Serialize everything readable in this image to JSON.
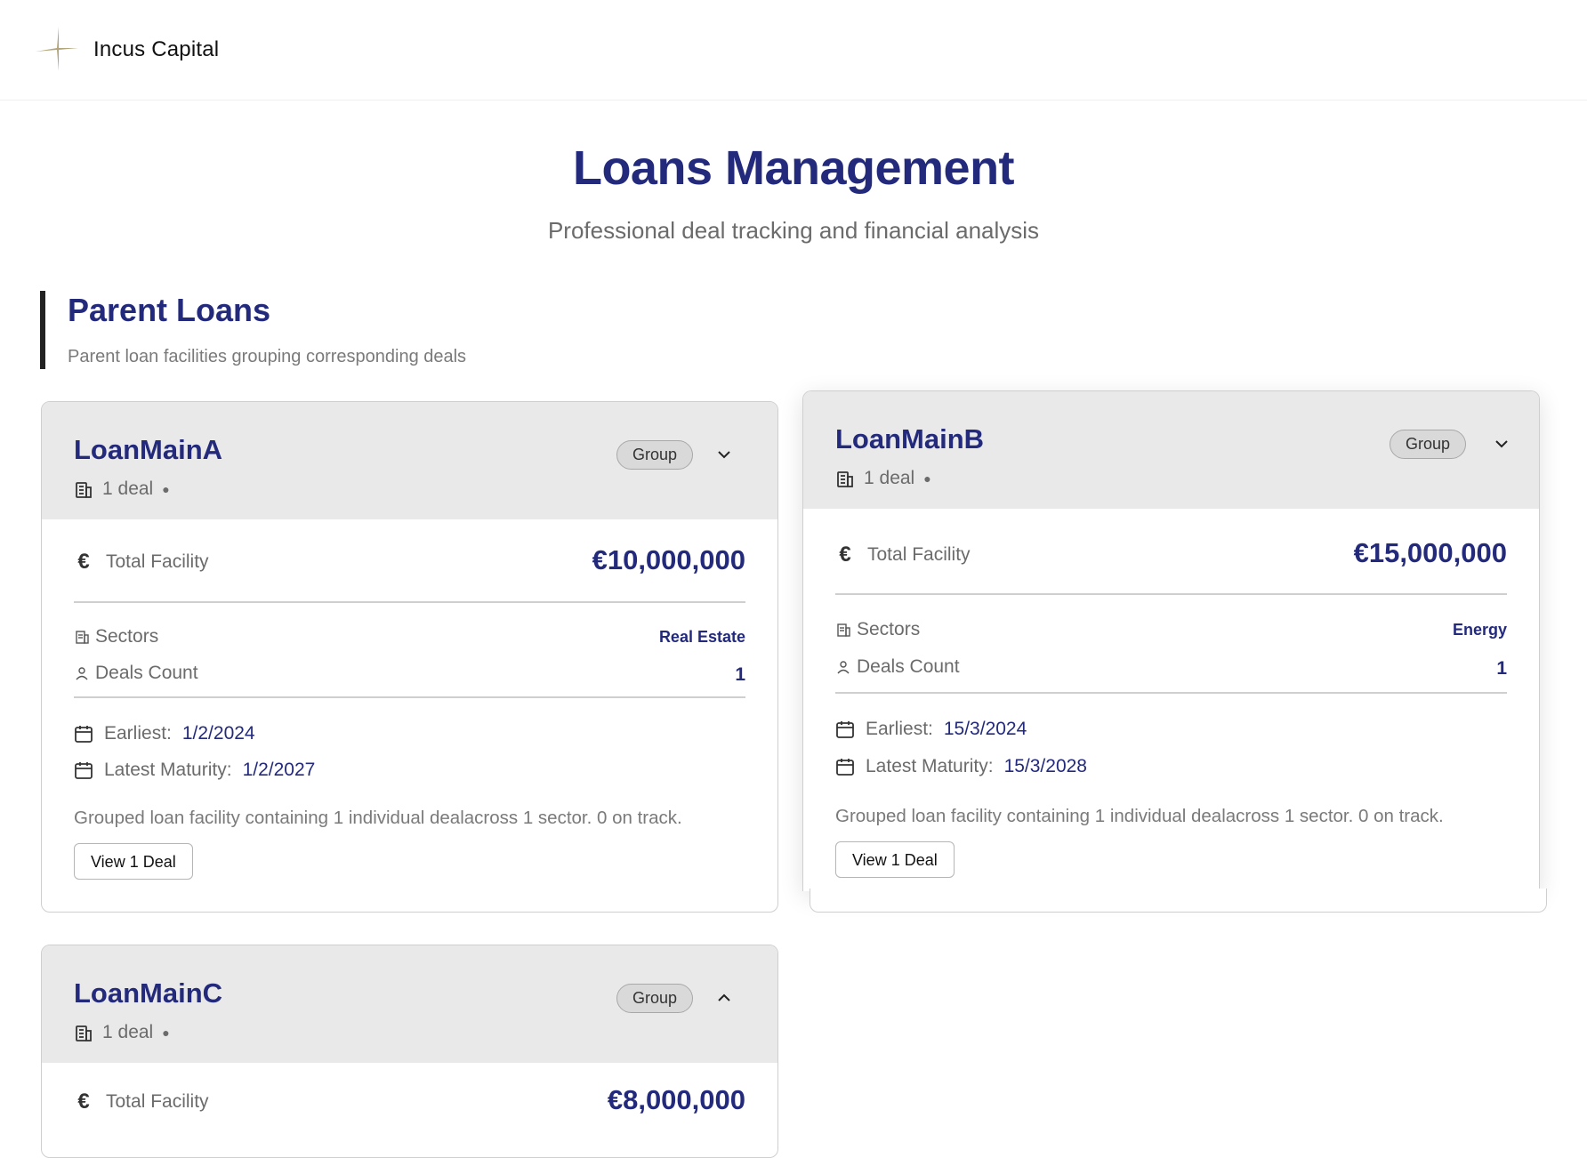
{
  "brand": {
    "name": "Incus Capital",
    "accent": "#b3a57a"
  },
  "hero": {
    "title": "Loans Management",
    "subtitle": "Professional deal tracking and financial analysis"
  },
  "section": {
    "title": "Parent Loans",
    "subtitle": "Parent loan facilities grouping corresponding deals"
  },
  "labels": {
    "total_facility": "Total Facility",
    "sectors": "Sectors",
    "deals_count": "Deals Count",
    "earliest": "Earliest:",
    "latest_maturity": "Latest Maturity:",
    "group_badge": "Group"
  },
  "loans": [
    {
      "name": "LoanMainA",
      "deal_count_text": "1 deal",
      "expanded": true,
      "total_facility": "€10,000,000",
      "sector": "Real Estate",
      "deals_count": "1",
      "earliest": "1/2/2024",
      "latest_maturity": "1/2/2027",
      "description": "Grouped loan facility containing 1 individual dealacross 1 sector. 0 on track.",
      "button": "View 1 Deal"
    },
    {
      "name": "LoanMainB",
      "deal_count_text": "1 deal",
      "expanded": true,
      "total_facility": "€15,000,000",
      "sector": "Energy",
      "deals_count": "1",
      "earliest": "15/3/2024",
      "latest_maturity": "15/3/2028",
      "description": "Grouped loan facility containing 1 individual dealacross 1 sector. 0 on track.",
      "button": "View 1 Deal"
    },
    {
      "name": "LoanMainC",
      "deal_count_text": "1 deal",
      "expanded": false,
      "total_facility": "€8,000,000"
    }
  ]
}
